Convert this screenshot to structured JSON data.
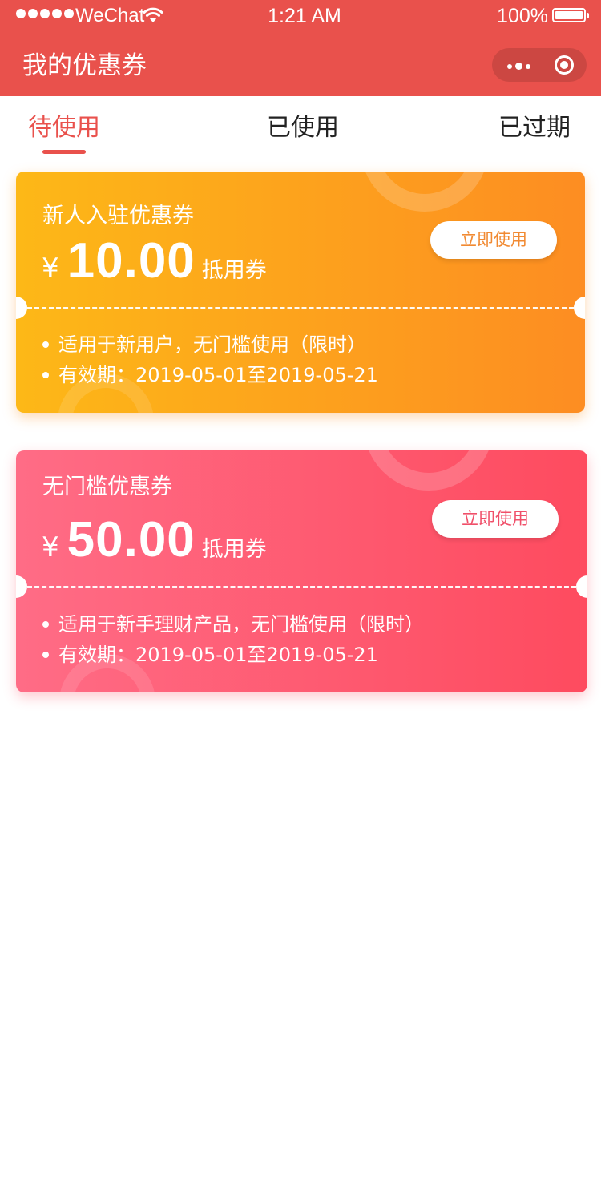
{
  "status_bar": {
    "carrier": "WeChat",
    "time": "1:21 AM",
    "battery_percent": "100%",
    "signal_bars": 5
  },
  "nav": {
    "title": "我的优惠券",
    "more_icon": "more-dots-icon",
    "close_icon": "target-circle-icon"
  },
  "tabs": [
    {
      "label": "待使用",
      "active": true
    },
    {
      "label": "已使用",
      "active": false
    },
    {
      "label": "已过期",
      "active": false
    }
  ],
  "coupons": [
    {
      "name": "新人入驻优惠券",
      "currency": "¥",
      "amount": "10.00",
      "unit": "抵用券",
      "button": "立即使用",
      "rules": [
        "适用于新用户，无门槛使用（限时）",
        "有效期：2019-05-01至2019-05-21"
      ],
      "colors": {
        "from": "#fdb817",
        "to": "#fd8d22"
      }
    },
    {
      "name": "无门槛优惠券",
      "currency": "¥",
      "amount": "50.00",
      "unit": "抵用券",
      "button": "立即使用",
      "rules": [
        "适用于新手理财产品，无门槛使用（限时）",
        "有效期：2019-05-01至2019-05-21"
      ],
      "colors": {
        "from": "#ff6c86",
        "to": "#fe4b5f"
      }
    }
  ],
  "colors": {
    "accent": "#e9514c"
  }
}
